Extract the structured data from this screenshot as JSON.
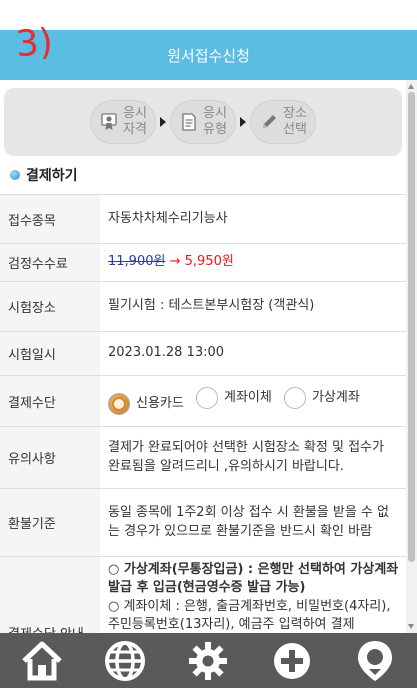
{
  "annotation": "3)",
  "header": {
    "title": "원서접수신청"
  },
  "steps": [
    {
      "label": "응시\n자격",
      "icon": "certificate-icon"
    },
    {
      "label": "응시\n유형",
      "icon": "document-icon"
    },
    {
      "label": "장소\n선택",
      "icon": "pencil-icon"
    }
  ],
  "section": {
    "title": "결제하기"
  },
  "rows": {
    "exam_type": {
      "label": "접수종목",
      "value": "자동차차체수리기능사"
    },
    "fee": {
      "label": "검정수수료",
      "original": "11,900원",
      "arrow": "→",
      "discounted": "5,950원"
    },
    "venue": {
      "label": "시험장소",
      "value": "필기시험 : 테스트본부시험장 (객관식)"
    },
    "datetime": {
      "label": "시험일시",
      "value": "2023.01.28 13:00"
    },
    "payment": {
      "label": "결제수단",
      "options": [
        "신용카드",
        "계좌이체",
        "가상계좌"
      ],
      "selected": "신용카드"
    },
    "notice": {
      "label": "유의사항",
      "value": "결제가 완료되어야 선택한 시험장소 확정 및 접수가 완료됨을 알려드리니 ,유의하시기 바랍니다."
    },
    "refund": {
      "label": "환불기준",
      "value": "동일 종목에 1주2회 이상 접수 시 환불을 받을 수 없는 경우가 있으므로 환불기준을 반드시 확인 바람"
    },
    "guide": {
      "label": "결제수단 안내",
      "line1": "○ 가상계좌(무통장입금) : 은행만 선택하여 가상계좌 발급 후 입금(현금영수증 발급 가능)",
      "line2": "○ 계좌이체 : 은행, 출금계좌번호, 비밀번호(4자리), 주민등록번호(13자리), 예금주 입력하여 결제"
    }
  },
  "tabbar": {
    "items": [
      {
        "icon": "home-icon"
      },
      {
        "icon": "globe-icon"
      },
      {
        "icon": "gear-icon"
      },
      {
        "icon": "plus-icon"
      },
      {
        "icon": "location-icon"
      }
    ]
  },
  "colors": {
    "header": "#5bbce4",
    "tabbar": "#5a5a5a",
    "price_old": "#2e3aa8",
    "price_new": "#e8181c"
  }
}
